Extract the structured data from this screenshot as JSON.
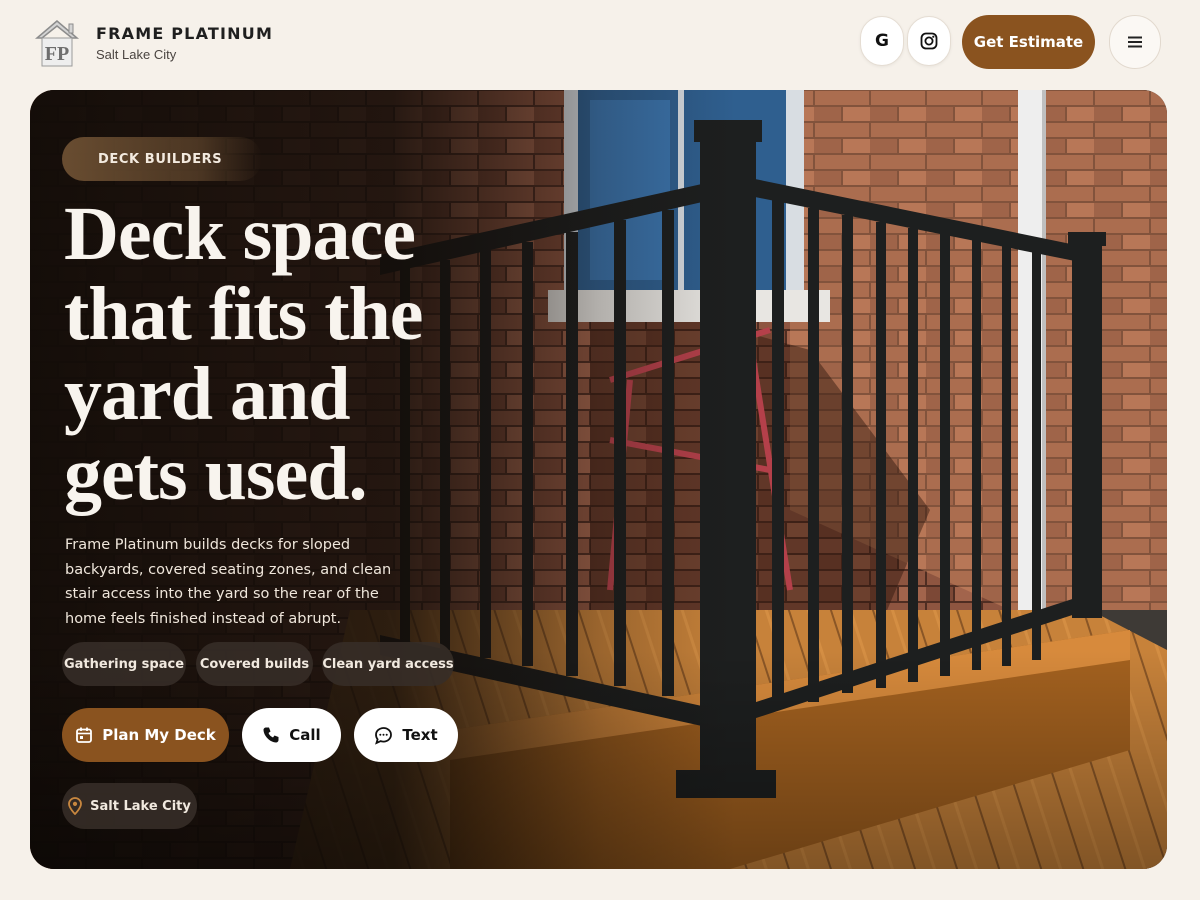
{
  "header": {
    "brand_name": "FRAME PLATINUM",
    "brand_city": "Salt Lake City",
    "logo_monogram": "FP",
    "google_letter": "G",
    "estimate_label": "Get Estimate",
    "menu_icon": "hamburger-icon"
  },
  "hero": {
    "eyebrow": "DECK BUILDERS",
    "headline": "Deck space that fits the yard and gets used.",
    "subtext": "Frame Platinum builds decks for sloped backyards, covered seating zones, and clean stair access into the yard so the rear of the home feels finished instead of abrupt.",
    "chips": [
      "Gathering space",
      "Covered builds",
      "Clean yard access"
    ],
    "cta_plan": "Plan My Deck",
    "cta_call": "Call",
    "cta_text": "Text",
    "location": "Salt Lake City"
  },
  "colors": {
    "accent": "#8a531f",
    "page_background": "#f6f1ea",
    "chip_background": "#372e28"
  },
  "icons": {
    "plan": "calendar-icon",
    "call": "phone-icon",
    "text": "chat-bubble-icon",
    "location": "map-pin-icon",
    "social_1": "google-icon",
    "social_2": "instagram-icon"
  }
}
